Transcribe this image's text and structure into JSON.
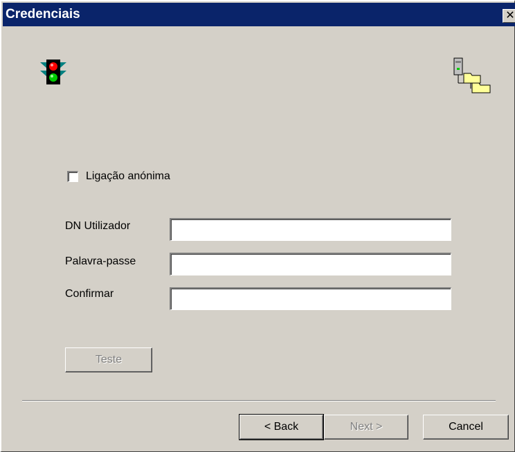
{
  "window": {
    "title": "Credenciais",
    "close_glyph": "✕"
  },
  "icons": {
    "status": "traffic-light-icon",
    "directory": "directory-folders-icon"
  },
  "anonymous_bind": {
    "label": "Ligação anónima",
    "checked": false
  },
  "fields": [
    {
      "label": "DN Utilizador",
      "value": ""
    },
    {
      "label": "Palavra-passe",
      "value": ""
    },
    {
      "label": "Confirmar",
      "value": ""
    }
  ],
  "test_button": {
    "label": "Teste",
    "enabled": false
  },
  "footer": {
    "back_label": "< Back",
    "next_label": "Next >",
    "cancel_label": "Cancel",
    "next_enabled": false
  },
  "colors": {
    "title_bar": "#0a246a",
    "dialog_face": "#d4d0c8",
    "traffic_red": "#ff0000",
    "traffic_green": "#00cc00",
    "folder_yellow": "#ffff99"
  }
}
